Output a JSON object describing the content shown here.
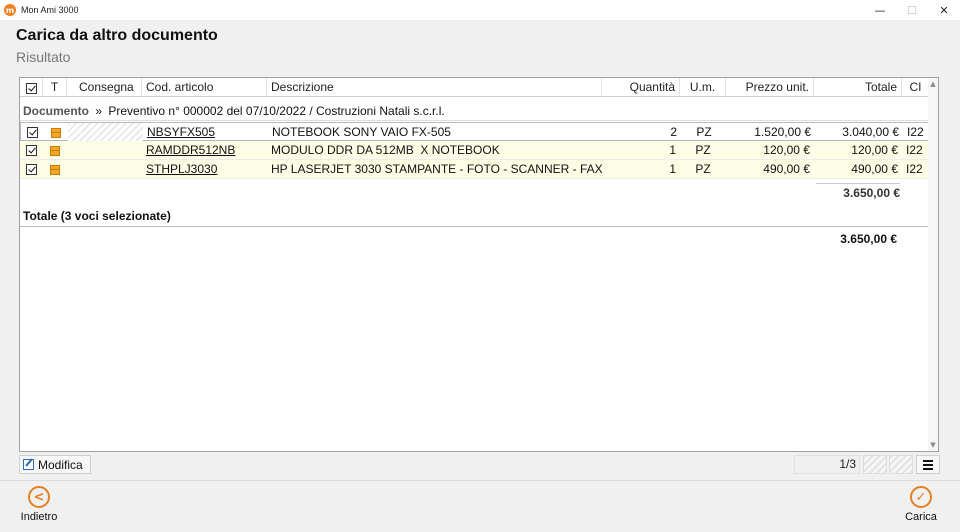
{
  "window": {
    "app_title": "Mon Ami 3000",
    "minimize": "—",
    "maximize": "☐",
    "close": "✕"
  },
  "header": {
    "title": "Carica da altro documento",
    "subtitle": "Risultato"
  },
  "columns": {
    "check": "",
    "t": "T",
    "consegna": "Consegna",
    "codice": "Cod. articolo",
    "descrizione": "Descrizione",
    "quantita": "Quantità",
    "um": "U.m.",
    "prezzo": "Prezzo unit.",
    "totale": "Totale",
    "ci": "CI"
  },
  "group": {
    "label": "Documento",
    "separator": "»",
    "text": "Preventivo n° 000002 del 07/10/2022 / Costruzioni Natali s.c.r.l."
  },
  "rows": [
    {
      "code": "NBSYFX505",
      "description": "NOTEBOOK SONY VAIO FX-505",
      "qty": "2",
      "um": "PZ",
      "price": "1.520,00 €",
      "total": "3.040,00 €",
      "ci": "I22"
    },
    {
      "code": "RAMDDR512NB",
      "description": "MODULO DDR DA 512MB  X NOTEBOOK",
      "qty": "1",
      "um": "PZ",
      "price": "120,00 €",
      "total": "120,00 €",
      "ci": "I22"
    },
    {
      "code": "STHPLJ3030",
      "description": "HP LASERJET 3030 STAMPANTE - FOTO - SCANNER - FAX",
      "qty": "1",
      "um": "PZ",
      "price": "490,00 €",
      "total": "490,00 €",
      "ci": "I22"
    }
  ],
  "subtotal": "3.650,00 €",
  "total_label": "Totale (3 voci selezionate)",
  "total_value": "3.650,00 €",
  "toolbar": {
    "modifica": "Modifica",
    "pager": "1/3"
  },
  "footer": {
    "back_label": "Indietro",
    "load_label": "Carica"
  }
}
